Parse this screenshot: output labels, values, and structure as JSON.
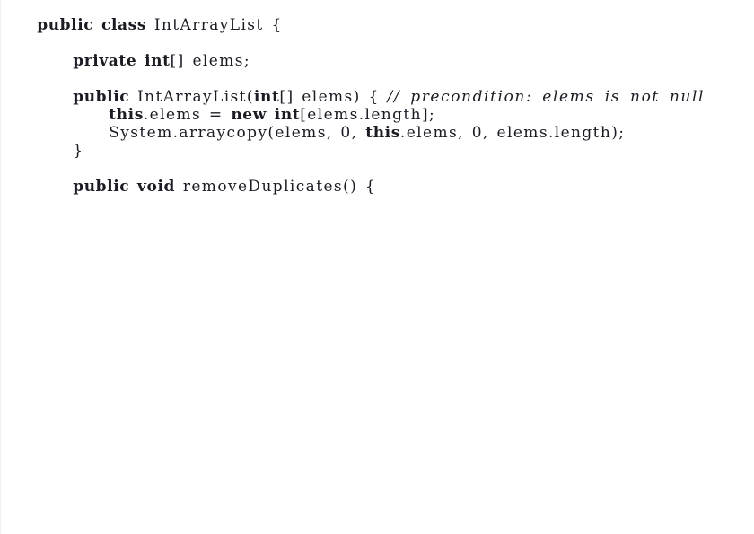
{
  "document": {
    "type": "java-code-listing",
    "lines": [
      {
        "indent": 0,
        "tokens": [
          {
            "kind": "keyword",
            "text": "public"
          },
          {
            "kind": "plain",
            "text": " "
          },
          {
            "kind": "keyword",
            "text": "class"
          },
          {
            "kind": "plain",
            "text": " IntArrayList {"
          }
        ]
      },
      {
        "indent": 1,
        "tokens": [
          {
            "kind": "keyword",
            "text": "private"
          },
          {
            "kind": "plain",
            "text": " "
          },
          {
            "kind": "keyword",
            "text": "int"
          },
          {
            "kind": "plain",
            "text": "[] elems;"
          }
        ]
      },
      {
        "indent": 1,
        "tokens": [
          {
            "kind": "keyword",
            "text": "public"
          },
          {
            "kind": "plain",
            "text": " IntArrayList("
          },
          {
            "kind": "keyword",
            "text": "int"
          },
          {
            "kind": "plain",
            "text": "[] elems) { "
          },
          {
            "kind": "comment",
            "text": "// precondition: elems is not null"
          }
        ]
      },
      {
        "indent": 2,
        "tokens": [
          {
            "kind": "keyword",
            "text": "this"
          },
          {
            "kind": "plain",
            "text": ".elems = "
          },
          {
            "kind": "keyword",
            "text": "new"
          },
          {
            "kind": "plain",
            "text": " "
          },
          {
            "kind": "keyword",
            "text": "int"
          },
          {
            "kind": "plain",
            "text": "[elems.length];"
          }
        ]
      },
      {
        "indent": 2,
        "tokens": [
          {
            "kind": "plain",
            "text": "System.arraycopy(elems, 0, "
          },
          {
            "kind": "keyword",
            "text": "this"
          },
          {
            "kind": "plain",
            "text": ".elems, 0, elems.length);"
          }
        ]
      },
      {
        "indent": 1,
        "tokens": [
          {
            "kind": "plain",
            "text": "}"
          }
        ]
      },
      {
        "indent": 1,
        "tokens": [
          {
            "kind": "keyword",
            "text": "public"
          },
          {
            "kind": "plain",
            "text": " "
          },
          {
            "kind": "keyword",
            "text": "void"
          },
          {
            "kind": "plain",
            "text": " removeDuplicates() {"
          }
        ]
      }
    ]
  }
}
